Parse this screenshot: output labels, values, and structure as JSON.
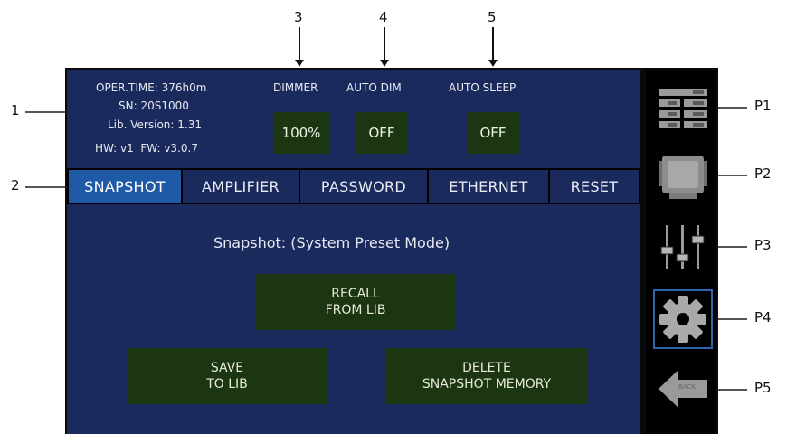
{
  "callouts": {
    "c1": "1",
    "c2": "2",
    "c3": "3",
    "c4": "4",
    "c5": "5",
    "p1": "P1",
    "p2": "P2",
    "p3": "P3",
    "p4": "P4",
    "p5": "P5"
  },
  "status": {
    "oper_time": "OPER.TIME: 376h0m",
    "sn": "SN: 20S1000",
    "lib_version": "Lib. Version: 1.31",
    "hw_fw": "HW: v1  FW: v3.0.7"
  },
  "settings": {
    "dimmer_label": "DIMMER",
    "dimmer_value": "100%",
    "auto_dim_label": "AUTO DIM",
    "auto_dim_value": "OFF",
    "auto_sleep_label": "AUTO SLEEP",
    "auto_sleep_value": "OFF"
  },
  "tabs": {
    "snapshot": "SNAPSHOT",
    "amplifier": "AMPLIFIER",
    "password": "PASSWORD",
    "ethernet": "ETHERNET",
    "reset": "RESET"
  },
  "main": {
    "heading": "Snapshot: (System Preset Mode)",
    "recall_line1": "RECALL",
    "recall_line2": "FROM LIB",
    "save_line1": "SAVE",
    "save_line2": "TO LIB",
    "delete_line1": "DELETE",
    "delete_line2": "SNAPSHOT MEMORY"
  },
  "sidebar": {
    "p1_icon": "list-grid-icon",
    "p2_icon": "amplifier-module-icon",
    "p3_icon": "faders-icon",
    "p4_icon": "gear-icon",
    "p5_icon": "back-arrow-icon",
    "back_text": "BACK"
  },
  "colors": {
    "screen": "#1b2a5c",
    "active_tab": "#1f5aa6",
    "button": "#1c3612",
    "pointer": "#f5b041"
  }
}
